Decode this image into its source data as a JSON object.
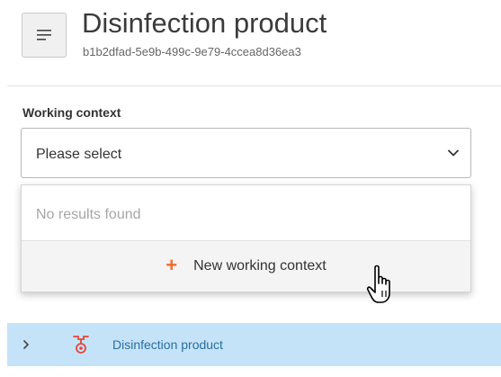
{
  "header": {
    "title": "Disinfection product",
    "subtitle": "b1b2dfad-5e9b-499c-9e79-4ccea8d36ea3",
    "menu_icon": "menu-lines-icon"
  },
  "field": {
    "label": "Working context",
    "selected_value": "Please select",
    "chevron_icon": "chevron-down-icon"
  },
  "dropdown": {
    "empty_text": "No results found",
    "new_option_label": "New working context",
    "plus_icon": "plus-icon",
    "accent_color": "#f26b2b"
  },
  "tree": {
    "items": [
      {
        "label": "Disinfection product",
        "icon": "disinfection-product-icon",
        "expand_icon": "chevron-right-icon"
      }
    ],
    "highlight_color": "#c5e3f8"
  },
  "cursor": {
    "icon": "hand-pointer-cursor-icon"
  }
}
